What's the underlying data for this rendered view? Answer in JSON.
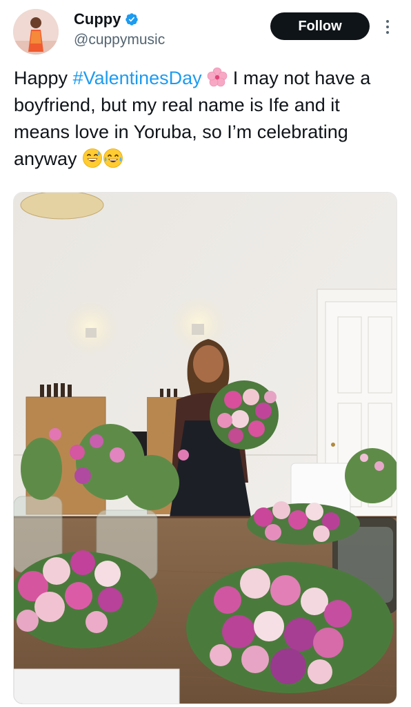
{
  "header": {
    "display_name": "Cuppy",
    "handle": "@cuppymusic",
    "follow_label": "Follow",
    "verified_color": "#1d9bf0"
  },
  "tweet": {
    "text_part1": "Happy ",
    "hashtag": "#ValentinesDay",
    "text_part2": " I may not have a boyfriend, but my real name is Ife and it means love in Yoruba, so I’m celebrating anyway ",
    "emojis": [
      "cherry-blossom-emoji",
      "grinning-sweat-emoji",
      "tears-of-joy-emoji"
    ]
  },
  "colors": {
    "hashtag": "#1d9bf0",
    "follow_bg": "#0f1419",
    "secondary_text": "#536471"
  }
}
